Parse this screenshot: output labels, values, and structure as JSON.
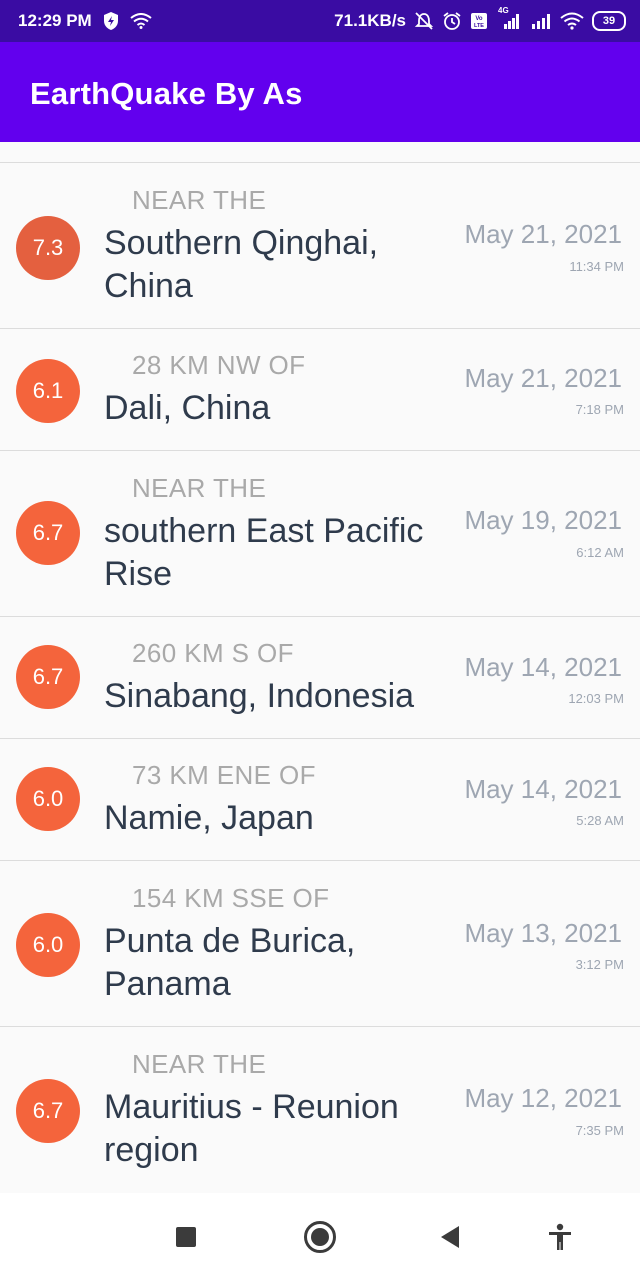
{
  "status_bar": {
    "time": "12:29 PM",
    "speed": "71.1KB/s",
    "network": "4G",
    "battery": "39",
    "icons": [
      "shield-icon",
      "wifi-icon",
      "alarm-off-icon",
      "alarm-icon",
      "volte-icon",
      "signal-icon",
      "signal-icon",
      "wifi-icon",
      "battery-icon"
    ]
  },
  "app_bar": {
    "title": "EarthQuake By As"
  },
  "earthquakes": [
    {
      "mag": "7.3",
      "color": "#e4603f",
      "offset": "NEAR THE",
      "place": "Southern Qinghai, China",
      "date": "May 21, 2021",
      "time": "11:34 PM"
    },
    {
      "mag": "6.1",
      "color": "#f4643c",
      "offset": "28 KM NW OF",
      "place": "Dali, China",
      "date": "May 21, 2021",
      "time": "7:18 PM"
    },
    {
      "mag": "6.7",
      "color": "#f4643c",
      "offset": "NEAR THE",
      "place": "southern East Pacific Rise",
      "date": "May 19, 2021",
      "time": "6:12 AM"
    },
    {
      "mag": "6.7",
      "color": "#f4643c",
      "offset": "260 KM S OF",
      "place": "Sinabang, Indonesia",
      "date": "May 14, 2021",
      "time": "12:03 PM"
    },
    {
      "mag": "6.0",
      "color": "#f4643c",
      "offset": "73 KM ENE OF",
      "place": "Namie, Japan",
      "date": "May 14, 2021",
      "time": "5:28 AM"
    },
    {
      "mag": "6.0",
      "color": "#f4643c",
      "offset": "154 KM SSE OF",
      "place": "Punta de Burica, Panama",
      "date": "May 13, 2021",
      "time": "3:12 PM"
    },
    {
      "mag": "6.7",
      "color": "#f4643c",
      "offset": "NEAR THE",
      "place": "Mauritius - Reunion region",
      "date": "May 12, 2021",
      "time": "7:35 PM"
    }
  ],
  "nav_bar": {
    "buttons": [
      "recents-icon",
      "home-icon",
      "back-icon",
      "accessibility-icon"
    ]
  },
  "colors": {
    "status_bar": "#3a0ca3",
    "app_bar": "#6200ee",
    "primary_text": "#2f3b4c",
    "secondary_text": "#a9a9a9"
  }
}
